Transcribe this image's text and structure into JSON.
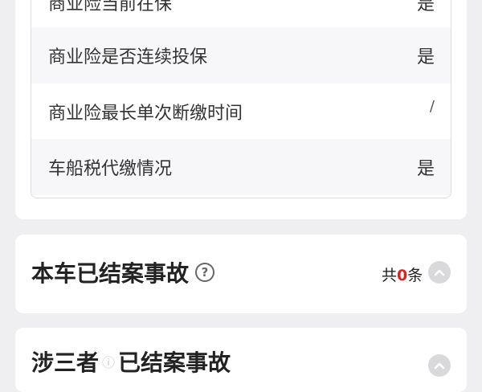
{
  "insurance_details": {
    "rows": [
      {
        "label": "商业险当前在保",
        "value": "是"
      },
      {
        "label": "商业险是否连续投保",
        "value": "是"
      },
      {
        "label": "商业险最长单次断缴时间",
        "value": "/"
      },
      {
        "label": "车船税代缴情况",
        "value": "是"
      }
    ]
  },
  "accidents": {
    "title": "本车已结案事故",
    "help_icon": "question-circle-icon",
    "count_prefix": "共",
    "count": "0",
    "count_suffix": "条",
    "toggle_icon": "chevron-up-icon"
  },
  "third_party": {
    "title_left": "涉三者",
    "title_right": "已结案事故",
    "toggle_icon": "chevron-up-icon"
  }
}
